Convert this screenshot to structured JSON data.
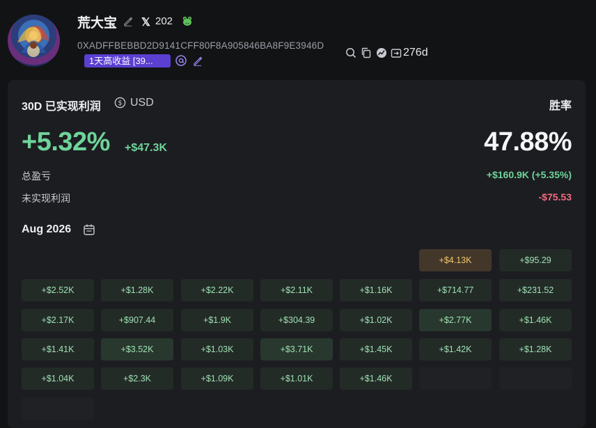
{
  "profile": {
    "name": "荒大宝",
    "x_count": "202",
    "x_label": "𝕏",
    "address": "0XADFFBEBBD2D9141CFF80F8A905846BA8F9E3946D",
    "tag": "1天高收益 [39...",
    "days": "276d",
    "icons": [
      "avatar-image",
      "edit-icon",
      "x-icon",
      "frog-icon",
      "at-icon",
      "search-icon",
      "copy-icon",
      "chart-icon",
      "wallet-icon"
    ]
  },
  "pnl": {
    "title": "30D 已实现利润",
    "currency": "USD",
    "winrate_label": "胜率",
    "percent": "+5.32%",
    "amount": "+$47.3K",
    "winrate": "47.88%",
    "total_label": "总盈亏",
    "total_value": "+$160.9K (+5.35%)",
    "unrealized_label": "未实现利润",
    "unrealized_value": "-$75.53"
  },
  "calendar": {
    "month": "Aug 2026",
    "rows": [
      [
        "",
        "",
        "",
        "",
        "",
        "+$4.13K",
        "+$95.29"
      ],
      [
        "+$2.52K",
        "+$1.28K",
        "+$2.22K",
        "+$2.11K",
        "+$1.16K",
        "+$714.77",
        "+$231.52"
      ],
      [
        "+$2.17K",
        "+$907.44",
        "+$1.9K",
        "+$304.39",
        "+$1.02K",
        "+$2.77K",
        "+$1.46K"
      ],
      [
        "+$1.41K",
        "+$3.52K",
        "+$1.03K",
        "+$3.71K",
        "+$1.45K",
        "+$1.42K",
        "+$1.28K"
      ],
      [
        "+$1.04K",
        "+$2.3K",
        "+$1.09K",
        "+$1.01K",
        "+$1.46K",
        "",
        ""
      ],
      [
        "",
        "",
        "",
        "",
        "",
        "",
        ""
      ]
    ]
  },
  "colors": {
    "positive": "#6fd49a",
    "negative": "#f06b7f",
    "tag_bg": "#5b3fd1",
    "neutral_cell": "#f3c76e"
  }
}
